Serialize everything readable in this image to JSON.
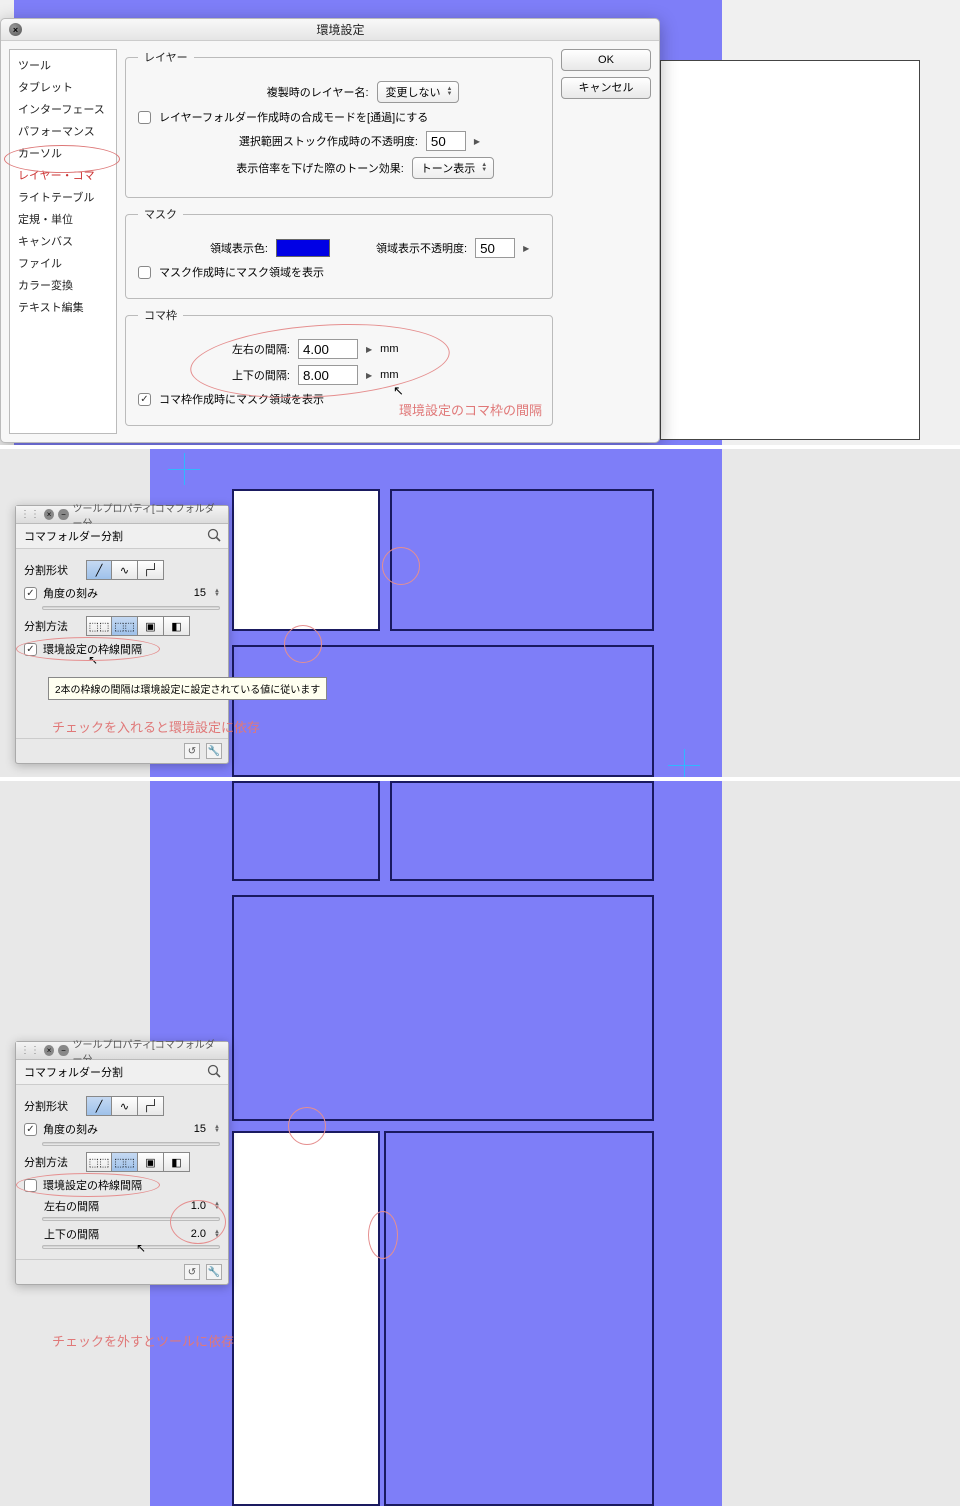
{
  "pref": {
    "title": "環境設定",
    "buttons": {
      "ok": "OK",
      "cancel": "キャンセル"
    },
    "sidebar": [
      "ツール",
      "タブレット",
      "インターフェース",
      "パフォーマンス",
      "カーソル",
      "レイヤー・コマ",
      "ライトテーブル",
      "定規・単位",
      "キャンバス",
      "ファイル",
      "カラー変換",
      "テキスト編集"
    ],
    "layer": {
      "legend": "レイヤー",
      "dup_label": "複製時のレイヤー名:",
      "dup_value": "変更しない",
      "folder_check": "レイヤーフォルダー作成時の合成モードを[通過]にする",
      "stock_label": "選択範囲ストック作成時の不透明度:",
      "stock_value": "50",
      "tone_label": "表示倍率を下げた際のトーン効果:",
      "tone_value": "トーン表示"
    },
    "mask": {
      "legend": "マスク",
      "color_label": "領域表示色:",
      "opacity_label": "領域表示不透明度:",
      "opacity_value": "50",
      "check": "マスク作成時にマスク領域を表示"
    },
    "koma": {
      "legend": "コマ枠",
      "lr_label": "左右の間隔:",
      "lr_value": "4.00",
      "tb_label": "上下の間隔:",
      "tb_value": "8.00",
      "unit": "mm",
      "check": "コマ枠作成時にマスク領域を表示"
    },
    "annot1": "環境設定のコマ枠の間隔"
  },
  "tp": {
    "title": "ツールプロパティ[コマフォルダー分",
    "subtitle": "コマフォルダー分割",
    "shape_label": "分割形状",
    "angle_label": "角度の刻み",
    "angle_value": "15",
    "method_label": "分割方法",
    "envgap_label": "環境設定の枠線間隔",
    "tooltip": "2本の枠線の間隔は環境設定に設定されている値に従います",
    "lr_label": "左右の間隔",
    "lr_value": "1.0",
    "tb_label": "上下の間隔",
    "tb_value": "2.0"
  },
  "annot2": "チェックを入れると環境設定に依存",
  "annot3": "チェックを外すとツールに依存"
}
